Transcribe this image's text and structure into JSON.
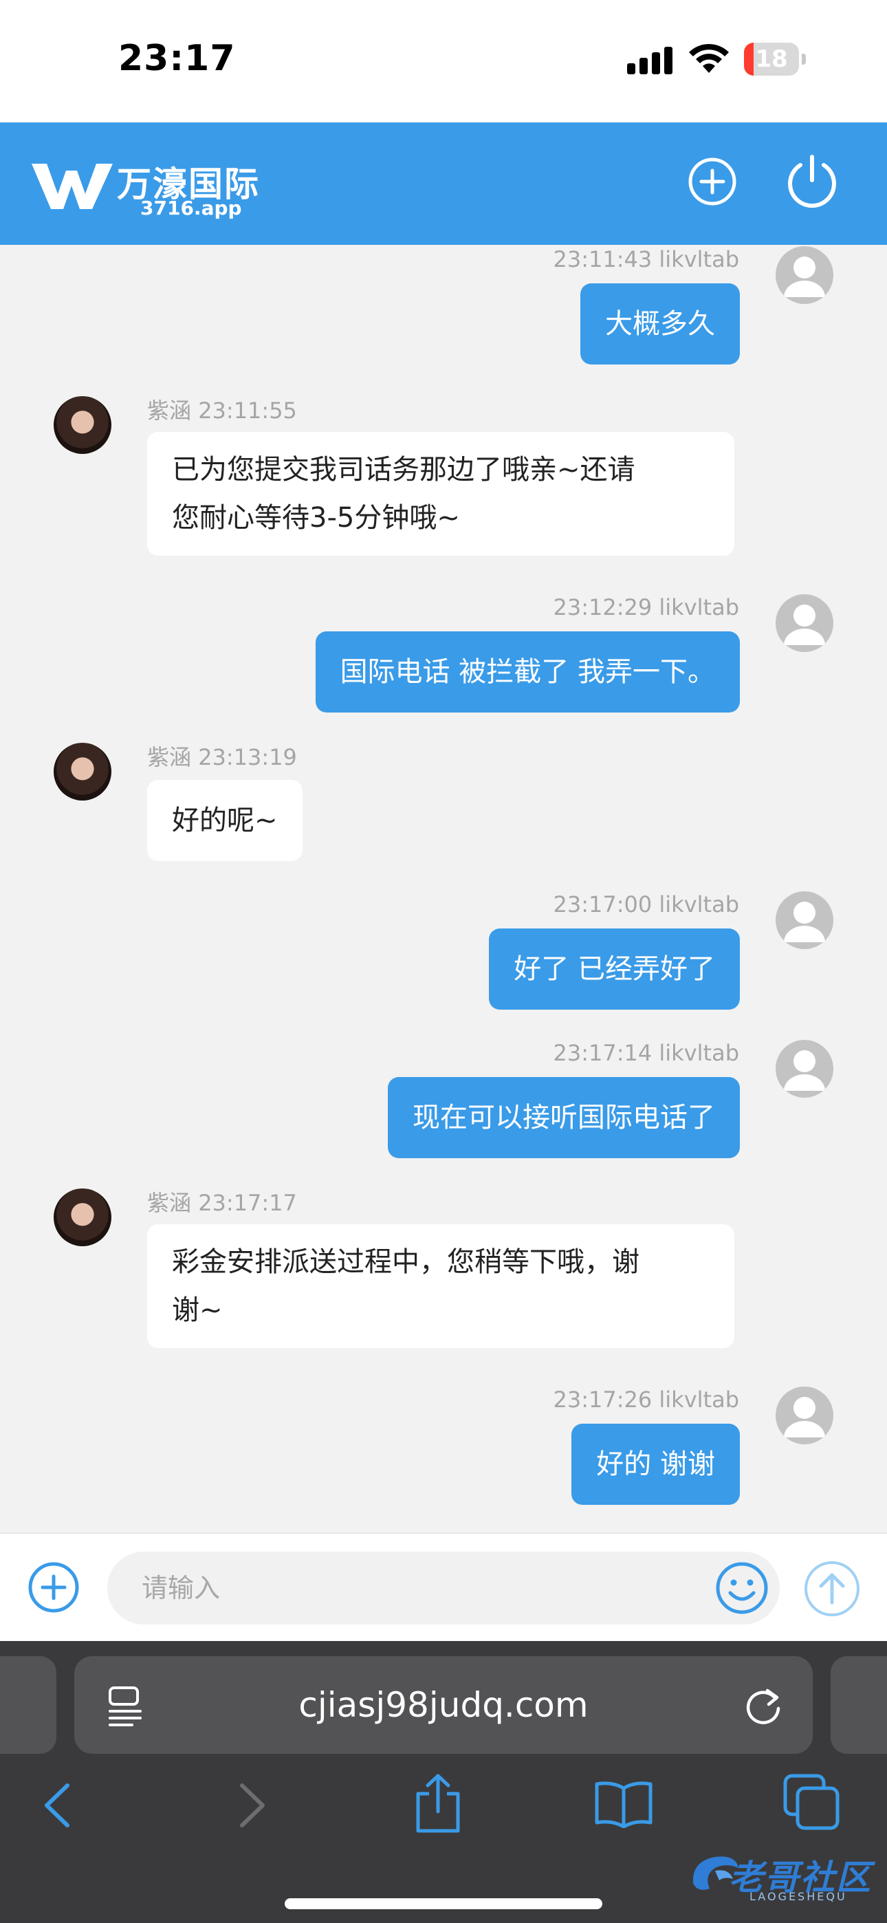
{
  "status_bar": {
    "time": "23:17",
    "battery_level": "18",
    "battery_fraction": 0.18,
    "battery_color": "#ff3b30",
    "icons": [
      "signal-icon",
      "wifi-icon",
      "battery-icon"
    ]
  },
  "header": {
    "logo_title": "万濠国际",
    "logo_subtitle": "3716.app",
    "add_icon": "plus-circle-icon",
    "power_icon": "power-icon",
    "background_color": "#3a9be8"
  },
  "messages": [
    {
      "sender": "user",
      "name": "likvltab",
      "time": "23:11:43",
      "text": "大概多久"
    },
    {
      "sender": "agent",
      "name": "紫涵",
      "time": "23:11:55",
      "text_lines": [
        "已为您提交我司话务那边了哦亲~还请",
        "您耐心等待3-5分钟哦~"
      ]
    },
    {
      "sender": "user",
      "name": "likvltab",
      "time": "23:12:29",
      "text": "国际电话 被拦截了  我弄一下。"
    },
    {
      "sender": "agent",
      "name": "紫涵",
      "time": "23:13:19",
      "text_lines": [
        "好的呢~"
      ]
    },
    {
      "sender": "user",
      "name": "likvltab",
      "time": "23:17:00",
      "text": "好了  已经弄好了"
    },
    {
      "sender": "user",
      "name": "likvltab",
      "time": "23:17:14",
      "text": "现在可以接听国际电话了"
    },
    {
      "sender": "agent",
      "name": "紫涵",
      "time": "23:17:17",
      "text_lines": [
        "彩金安排派送过程中，您稍等下哦，谢",
        "谢~"
      ]
    },
    {
      "sender": "user",
      "name": "likvltab",
      "time": "23:17:26",
      "text": "好的  谢谢"
    }
  ],
  "input": {
    "placeholder": "请输入",
    "add_icon": "plus-circle-icon",
    "emoji_icon": "smiley-icon",
    "send_icon": "send-arrow-icon"
  },
  "browser": {
    "url": "cjiasj98judq.com",
    "icons": [
      "reader-icon",
      "reload-icon",
      "back-icon",
      "forward-icon",
      "share-icon",
      "bookmarks-icon",
      "tabs-icon"
    ]
  },
  "watermark": {
    "text": "老哥社区",
    "subtext": "LAOGESHEQU"
  }
}
